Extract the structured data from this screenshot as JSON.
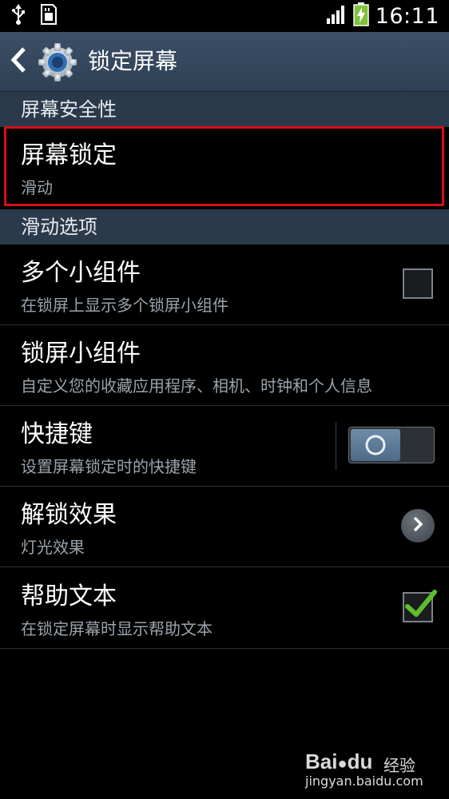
{
  "status_bar": {
    "time": "16:11",
    "icons": [
      "usb-icon",
      "sd-card-icon",
      "signal-icon",
      "battery-charging-icon"
    ]
  },
  "app_bar": {
    "title": "锁定屏幕",
    "icons": [
      "back-arrow-icon",
      "settings-gear-icon"
    ]
  },
  "sections": [
    {
      "header": "屏幕安全性",
      "items": [
        {
          "title": "屏幕锁定",
          "subtitle": "滑动"
        }
      ]
    },
    {
      "header": "滑动选项",
      "items": [
        {
          "title": "多个小组件",
          "subtitle": "在锁屏上显示多个锁屏小组件",
          "control": "checkbox",
          "checked": false
        },
        {
          "title": "锁屏小组件",
          "subtitle": "自定义您的收藏应用程序、相机、时钟和个人信息"
        },
        {
          "title": "快捷键",
          "subtitle": "设置屏幕锁定时的快捷键",
          "control": "toggle",
          "on": false
        },
        {
          "title": "解锁效果",
          "subtitle": "灯光效果",
          "control": "chevron-right-icon"
        },
        {
          "title": "帮助文本",
          "subtitle": "在锁定屏幕时显示帮助文本",
          "control": "checkbox",
          "checked": true
        }
      ]
    }
  ],
  "watermark": {
    "logo": "Bai",
    "logo2": "du",
    "text": "经验",
    "url": "jingyan.baidu.com"
  },
  "colors": {
    "app_bar": "#34475c",
    "section_header": "#2b3a4b",
    "highlight_border": "#d80d10",
    "check_green": "#5fbd2b"
  }
}
